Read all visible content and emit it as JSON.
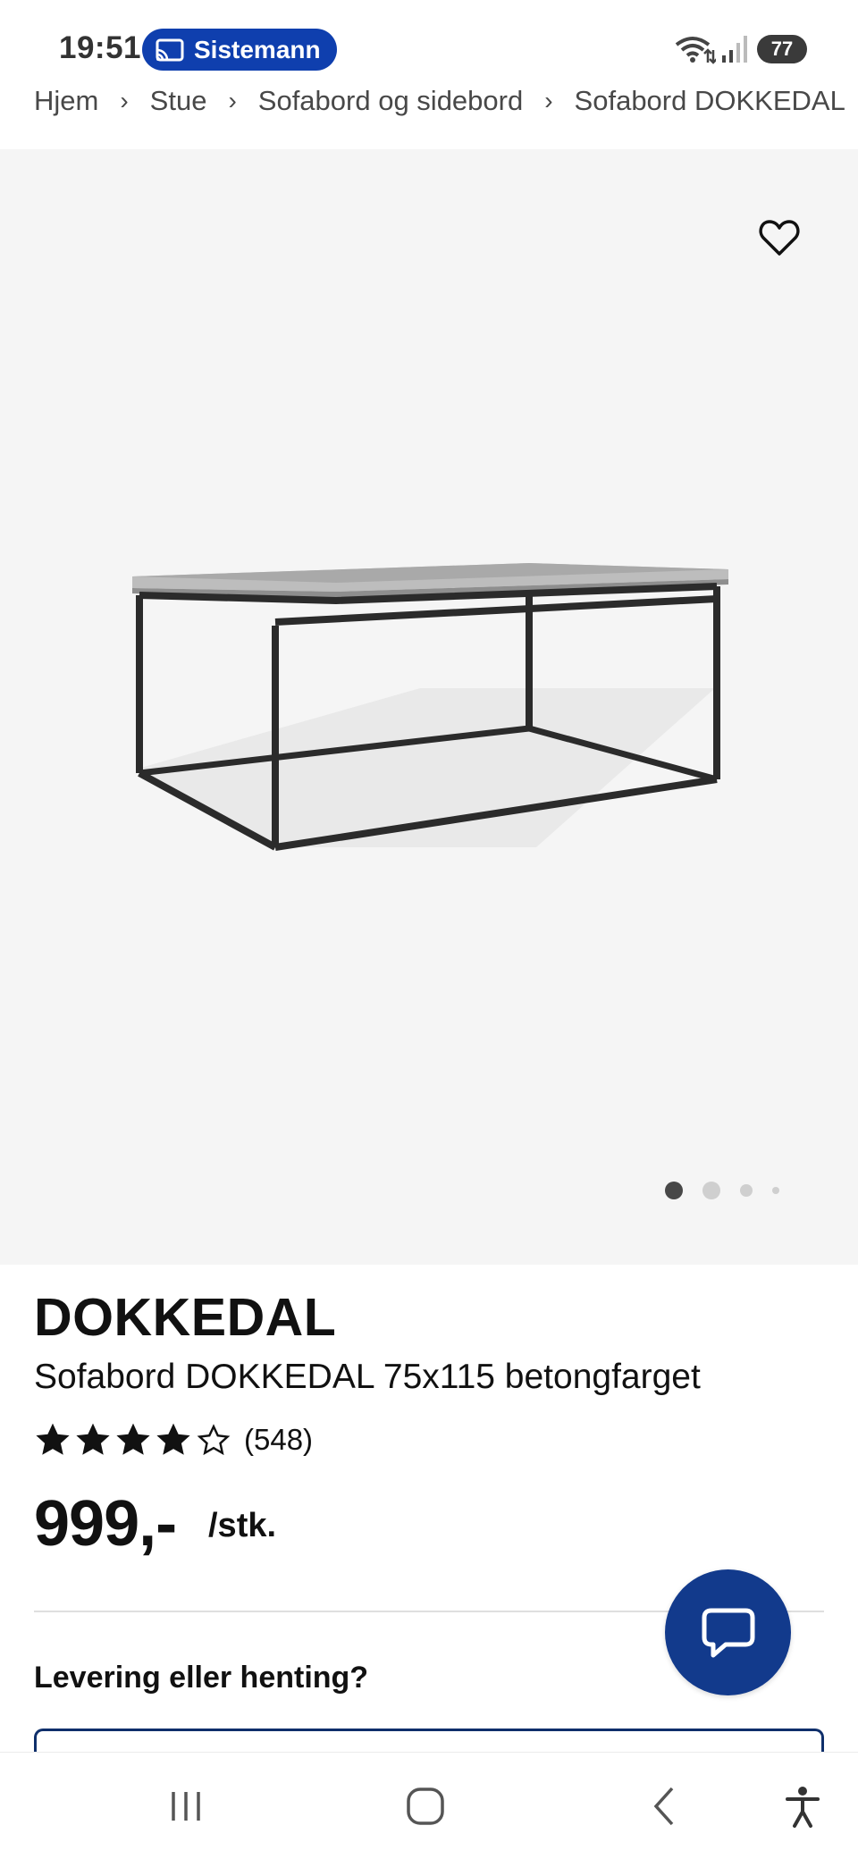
{
  "status_bar": {
    "time": "19:51",
    "cast_label": "Sistemann",
    "battery": "77",
    "icons": [
      "cast-icon",
      "wifi-icon",
      "signal-icon",
      "battery-icon"
    ]
  },
  "breadcrumb": [
    "Hjem",
    "Stue",
    "Sofabord og sidebord",
    "Sofabord DOKKEDAL"
  ],
  "gallery": {
    "favorite_icon": "heart-outline-icon",
    "image_count": 4,
    "active_index": 0
  },
  "product": {
    "brand": "DOKKEDAL",
    "subtitle": "Sofabord DOKKEDAL 75x115 betongfarget",
    "rating": 4,
    "rating_max": 5,
    "review_count": "(548)",
    "price": "999,-",
    "unit": "/stk."
  },
  "delivery": {
    "heading": "Levering eller henting?"
  },
  "chat": {
    "icon": "chat-bubble-icon"
  },
  "nav": [
    "recent-apps-icon",
    "home-icon",
    "back-icon",
    "accessibility-icon"
  ],
  "colors": {
    "accent": "#0f3fae",
    "chat": "#123a8c",
    "gallery_bg": "#f5f5f5"
  }
}
